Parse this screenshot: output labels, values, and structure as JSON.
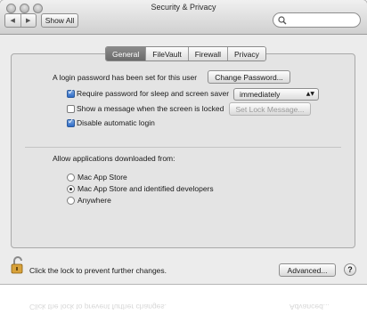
{
  "window": {
    "title": "Security & Privacy"
  },
  "toolbar": {
    "back_label": "◀",
    "forward_label": "▶",
    "show_all_label": "Show All",
    "search_placeholder": ""
  },
  "tabs": [
    {
      "label": "General",
      "active": true
    },
    {
      "label": "FileVault",
      "active": false
    },
    {
      "label": "Firewall",
      "active": false
    },
    {
      "label": "Privacy",
      "active": false
    }
  ],
  "general": {
    "login_password_text": "A login password has been set for this user",
    "change_password_label": "Change Password...",
    "require_password": {
      "label": "Require password for sleep and screen saver",
      "checked": true
    },
    "require_password_delay": "immediately",
    "show_message": {
      "label": "Show a message when the screen is locked",
      "checked": false
    },
    "set_lock_message_label": "Set Lock Message...",
    "disable_auto_login": {
      "label": "Disable automatic login",
      "checked": true
    },
    "allow_apps_heading": "Allow applications downloaded from:",
    "allow_apps_options": [
      {
        "label": "Mac App Store",
        "selected": false
      },
      {
        "label": "Mac App Store and identified developers",
        "selected": true
      },
      {
        "label": "Anywhere",
        "selected": false
      }
    ]
  },
  "footer": {
    "lock_text": "Click the lock to prevent further changes.",
    "advanced_label": "Advanced...",
    "help_label": "?"
  },
  "reflection": {
    "lock_text": "Click the lock to prevent further changes.",
    "advanced_label": "Advanced..."
  },
  "colors": {
    "checkbox_accent": "#2d6bc7",
    "window_bg": "#ececec"
  }
}
